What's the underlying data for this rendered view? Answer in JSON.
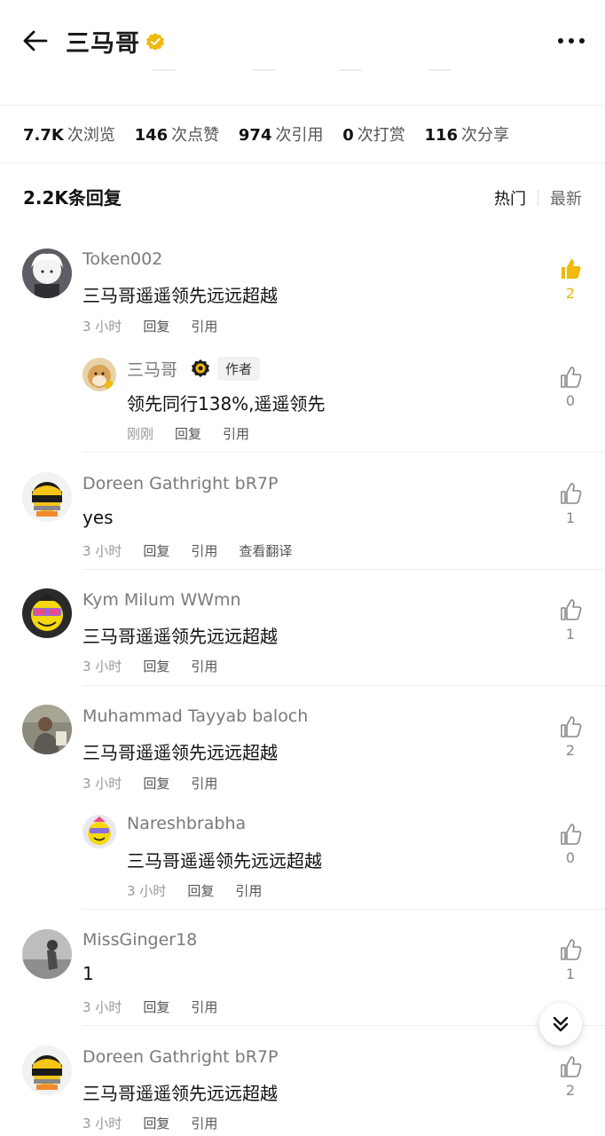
{
  "header": {
    "title": "三马哥",
    "back_icon": "arrow-left-icon",
    "more_icon": "more-icon"
  },
  "stats": [
    {
      "value": "7.7K",
      "label": "次浏览"
    },
    {
      "value": "146",
      "label": "次点赞"
    },
    {
      "value": "974",
      "label": "次引用"
    },
    {
      "value": "0",
      "label": "次打赏"
    },
    {
      "value": "116",
      "label": "次分享"
    }
  ],
  "replies": {
    "count_label": "2.2K条回复",
    "sort_hot": "热门",
    "sort_new": "最新"
  },
  "comments": [
    {
      "user": "Token002",
      "text": "三马哥遥遥领先远远超越",
      "time": "3 小时",
      "reply": "回复",
      "quote": "引用",
      "likes": "2"
    },
    {
      "user": "三马哥",
      "author_badge": "作者",
      "text": "领先同行138%,遥遥领先",
      "time": "刚刚",
      "reply": "回复",
      "quote": "引用",
      "likes": "0"
    },
    {
      "user": "Doreen Gathright bR7P",
      "text": "yes",
      "time": "3 小时",
      "reply": "回复",
      "quote": "引用",
      "translate": "查看翻译",
      "likes": "1"
    },
    {
      "user": "Kym Milum WWmn",
      "text": "三马哥遥遥领先远远超越",
      "time": "3 小时",
      "reply": "回复",
      "quote": "引用",
      "likes": "1"
    },
    {
      "user": "Muhammad Tayyab baloch",
      "text": "三马哥遥遥领先远远超越",
      "time": "3 小时",
      "reply": "回复",
      "quote": "引用",
      "likes": "2"
    },
    {
      "user": "Nareshbrabha",
      "text": "三马哥遥遥领先远远超越",
      "time": "3 小时",
      "reply": "回复",
      "quote": "引用",
      "likes": "0"
    },
    {
      "user": "MissGinger18",
      "text": "1",
      "time": "3 小时",
      "reply": "回复",
      "quote": "引用",
      "likes": "1"
    },
    {
      "user": "Doreen Gathright bR7P",
      "text": "三马哥遥遥领先远远超越",
      "time": "3 小时",
      "reply": "回复",
      "quote": "引用",
      "likes": "2"
    }
  ],
  "colors": {
    "accent": "#f0b90b",
    "text": "#111111",
    "muted": "#999999"
  }
}
